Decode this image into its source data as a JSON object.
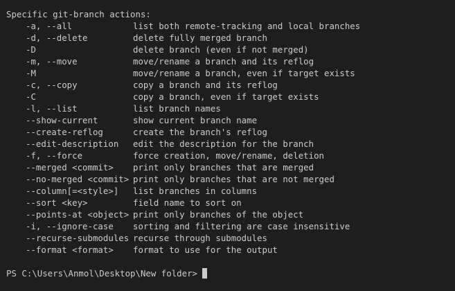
{
  "heading": "Specific git-branch actions:",
  "options": [
    {
      "flag": "-a, --all",
      "desc": "list both remote-tracking and local branches"
    },
    {
      "flag": "-d, --delete",
      "desc": "delete fully merged branch"
    },
    {
      "flag": "-D",
      "desc": "delete branch (even if not merged)"
    },
    {
      "flag": "-m, --move",
      "desc": "move/rename a branch and its reflog"
    },
    {
      "flag": "-M",
      "desc": "move/rename a branch, even if target exists"
    },
    {
      "flag": "-c, --copy",
      "desc": "copy a branch and its reflog"
    },
    {
      "flag": "-C",
      "desc": "copy a branch, even if target exists"
    },
    {
      "flag": "-l, --list",
      "desc": "list branch names"
    },
    {
      "flag": "--show-current",
      "desc": "show current branch name"
    },
    {
      "flag": "--create-reflog",
      "desc": "create the branch's reflog"
    },
    {
      "flag": "--edit-description",
      "desc": "edit the description for the branch"
    },
    {
      "flag": "-f, --force",
      "desc": "force creation, move/rename, deletion"
    },
    {
      "flag": "--merged <commit>",
      "desc": "print only branches that are merged"
    },
    {
      "flag": "--no-merged <commit>",
      "desc": "print only branches that are not merged"
    },
    {
      "flag": "--column[=<style>]",
      "desc": "list branches in columns"
    },
    {
      "flag": "--sort <key>",
      "desc": "field name to sort on"
    },
    {
      "flag": "--points-at <object>",
      "desc": "print only branches of the object"
    },
    {
      "flag": "-i, --ignore-case",
      "desc": "sorting and filtering are case insensitive"
    },
    {
      "flag": "--recurse-submodules",
      "desc": "recurse through submodules"
    },
    {
      "flag": "--format <format>",
      "desc": "format to use for the output"
    }
  ],
  "prompt": "PS C:\\Users\\Anmol\\Desktop\\New folder>",
  "colors": {
    "background": "#1e1e1e",
    "foreground": "#cccccc"
  }
}
